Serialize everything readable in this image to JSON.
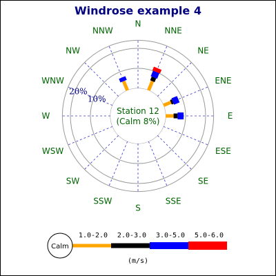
{
  "chart_data": {
    "type": "windrose",
    "title": "Windrose example 4",
    "center_labels": [
      "Station 12",
      "(Calm 8%)"
    ],
    "calm_percent": 8,
    "rings": [
      {
        "value": 10,
        "label": "10%"
      },
      {
        "value": 20,
        "label": "20%"
      }
    ],
    "max_value": 24,
    "directions": [
      "N",
      "NNE",
      "NE",
      "ENE",
      "E",
      "ESE",
      "SE",
      "SSE",
      "S",
      "SSW",
      "SW",
      "WSW",
      "W",
      "WNW",
      "NW",
      "NNW"
    ],
    "bins": [
      {
        "label": "1.0-2.0",
        "color": "#FFA500"
      },
      {
        "label": "2.0-3.0",
        "color": "#000000"
      },
      {
        "label": "3.0-5.0",
        "color": "#0000FF"
      },
      {
        "label": "5.0-6.0",
        "color": "#FF0000"
      }
    ],
    "calm_label": "Calm",
    "unit_label": "(m/s)",
    "data": [
      {
        "direction": "NNE",
        "values": [
          5,
          2,
          3,
          2
        ]
      },
      {
        "direction": "ENE",
        "values": [
          4,
          1,
          3,
          0
        ]
      },
      {
        "direction": "E",
        "values": [
          4,
          2,
          3,
          0
        ]
      },
      {
        "direction": "NNW",
        "values": [
          5,
          0,
          2,
          0
        ]
      }
    ]
  }
}
